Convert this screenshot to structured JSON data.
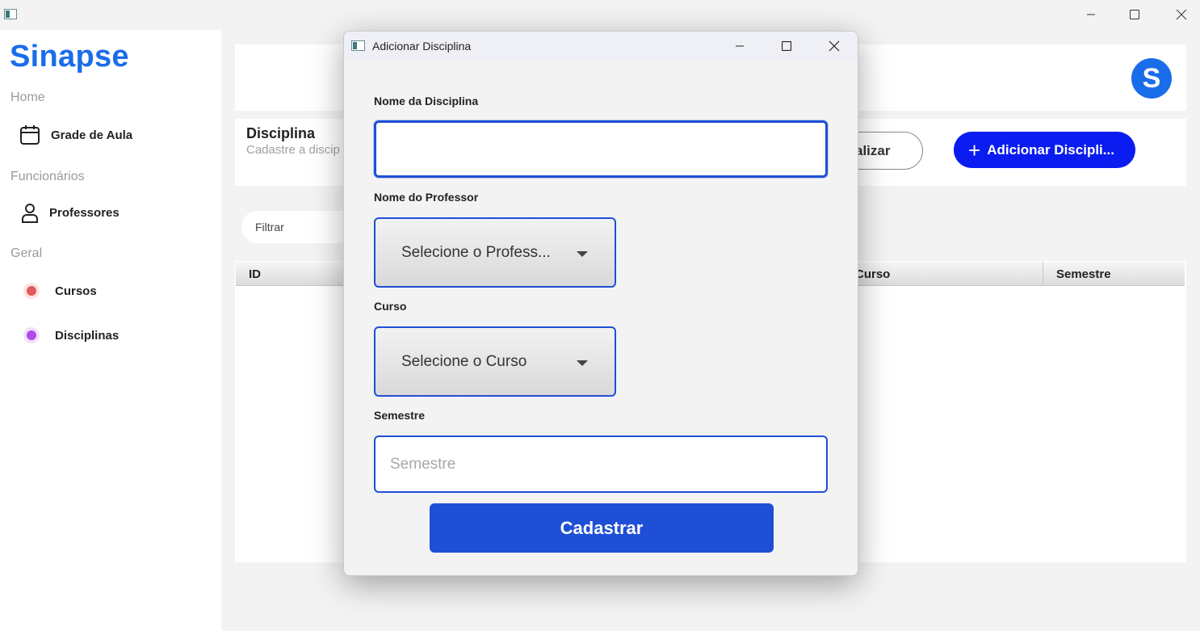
{
  "app": {
    "brand": "Sinapse",
    "avatar_letter": "S"
  },
  "sidebar": {
    "sections": {
      "home": "Home",
      "funcionarios": "Funcionários",
      "geral": "Geral"
    },
    "items": {
      "grade": {
        "label": "Grade de Aula",
        "icon": "calendar-icon"
      },
      "professores": {
        "label": "Professores",
        "icon": "person-icon"
      },
      "cursos": {
        "label": "Cursos",
        "icon": "dot-icon",
        "color": "#e05a5a"
      },
      "disciplinas": {
        "label": "Disciplinas",
        "icon": "dot-icon",
        "color": "#b04ae8"
      }
    }
  },
  "page": {
    "title": "Disciplina",
    "subtitle": "Cadastre a discip",
    "update_label": "alizar",
    "add_label": "Adicionar Discipli...",
    "add_plus": "+",
    "filter_placeholder": "Filtrar"
  },
  "table": {
    "columns": {
      "id": "ID",
      "curso": "Curso",
      "semestre": "Semestre"
    }
  },
  "modal": {
    "title": "Adicionar Disciplina",
    "fields": {
      "nome_label": "Nome da Disciplina",
      "nome_value": "",
      "professor_label": "Nome do Professor",
      "professor_selected": "Selecione o Profess...",
      "curso_label": "Curso",
      "curso_selected": "Selecione o Curso",
      "semestre_label": "Semestre",
      "semestre_placeholder": "Semestre"
    },
    "submit_label": "Cadastrar"
  },
  "colors": {
    "brand": "#1a6dea",
    "primary": "#1f4fd6",
    "add_button": "#0a1cf0"
  }
}
